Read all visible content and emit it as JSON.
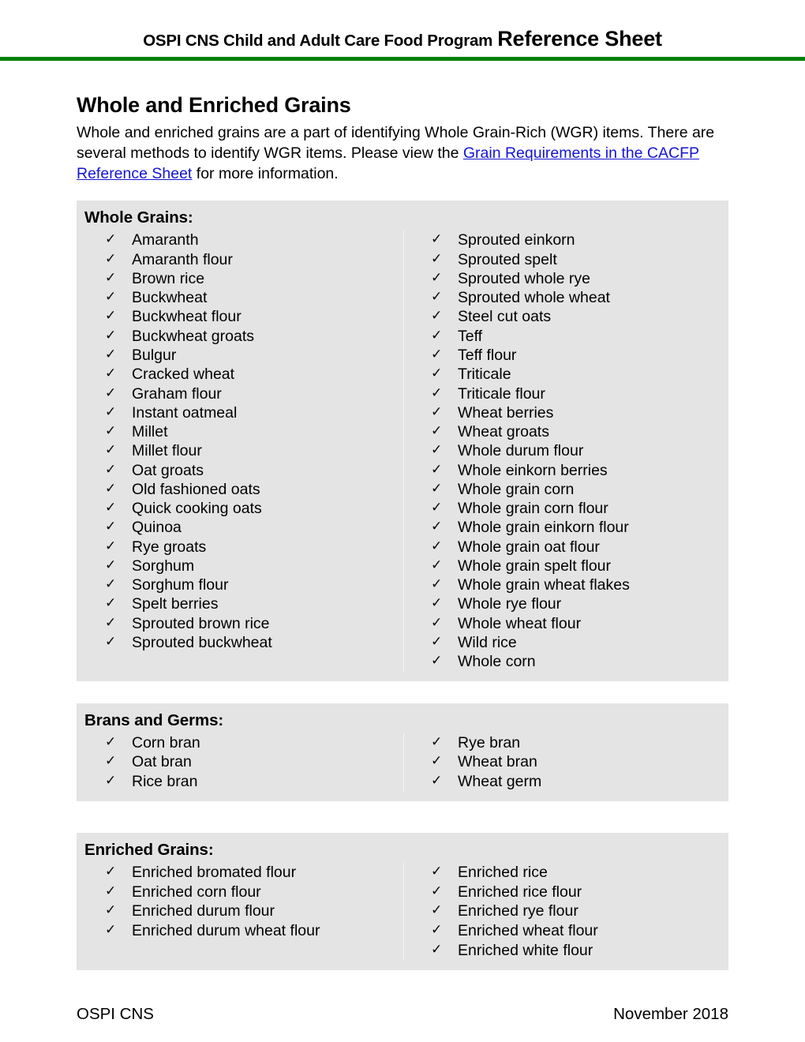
{
  "header": {
    "program_title": "OSPI CNS Child and Adult Care Food Program",
    "sheet_label": "Reference Sheet",
    "rule_color": "#008000"
  },
  "document": {
    "title": "Whole and Enriched Grains",
    "intro_part1": "Whole and enriched grains are a part of identifying Whole Grain-Rich (WGR) items. There are several methods to identify WGR items. Please view the ",
    "intro_link": "Grain Requirements in the CACFP Reference Sheet",
    "intro_part2": " for more information.",
    "link_color": "#1414d2"
  },
  "sections": [
    {
      "title": "Whole Grains:",
      "left_column": [
        "Amaranth",
        "Amaranth flour",
        "Brown rice",
        "Buckwheat",
        "Buckwheat flour",
        "Buckwheat groats",
        "Bulgur",
        "Cracked wheat",
        "Graham flour",
        "Instant oatmeal",
        "Millet",
        "Millet flour",
        "Oat groats",
        "Old fashioned oats",
        "Quick cooking oats",
        "Quinoa",
        "Rye groats",
        "Sorghum",
        "Sorghum flour",
        "Spelt berries",
        "Sprouted brown rice",
        "Sprouted buckwheat"
      ],
      "right_column": [
        "Sprouted einkorn",
        "Sprouted spelt",
        "Sprouted whole rye",
        "Sprouted whole wheat",
        "Steel cut oats",
        "Teff",
        "Teff flour",
        "Triticale",
        "Triticale flour",
        "Wheat berries",
        "Wheat groats",
        "Whole durum flour",
        "Whole einkorn berries",
        "Whole grain corn",
        "Whole grain corn flour",
        "Whole grain einkorn flour",
        "Whole grain oat flour",
        "Whole grain spelt flour",
        "Whole grain wheat flakes",
        "Whole rye flour",
        "Whole wheat flour",
        "Wild rice",
        "Whole corn"
      ]
    },
    {
      "title": "Brans and Germs:",
      "left_column": [
        "Corn bran",
        "Oat bran",
        "Rice bran"
      ],
      "right_column": [
        "Rye bran",
        "Wheat bran",
        "Wheat germ"
      ]
    },
    {
      "title": "Enriched Grains:",
      "left_column": [
        "Enriched bromated flour",
        "Enriched corn flour",
        "Enriched durum flour",
        "Enriched durum wheat flour"
      ],
      "right_column": [
        "Enriched rice",
        "Enriched rice flour",
        "Enriched rye flour",
        "Enriched wheat flour",
        "Enriched white flour"
      ]
    }
  ],
  "footer": {
    "left": "OSPI CNS",
    "right": "November 2018"
  },
  "icons": {
    "check": "✓"
  }
}
